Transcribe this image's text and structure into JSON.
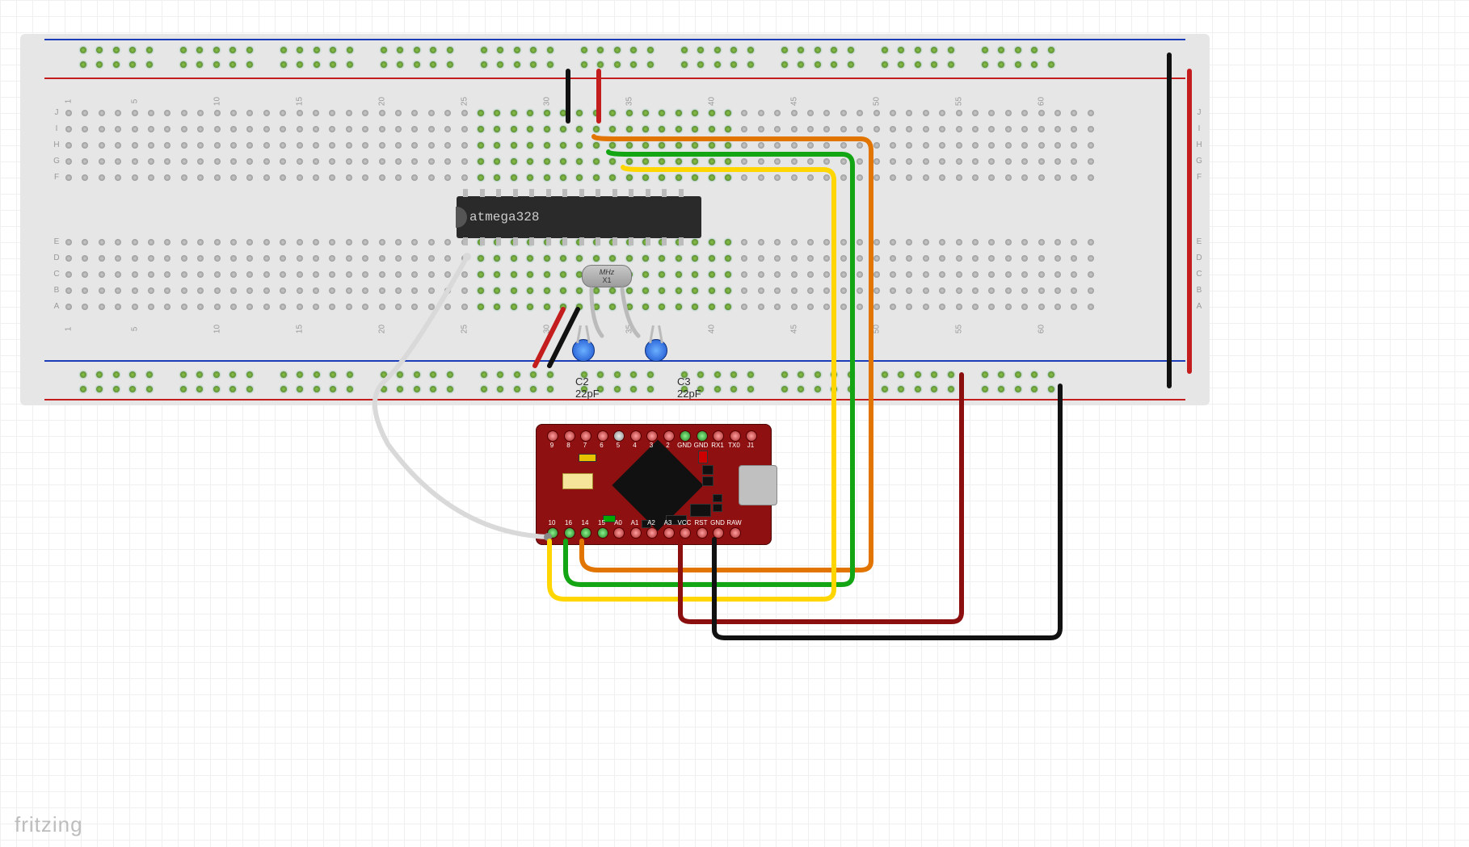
{
  "app": {
    "logo": "fritzing"
  },
  "chip": {
    "label": "atmega328"
  },
  "crystal": {
    "mhz": "MHz",
    "ref": "X1"
  },
  "capacitors": {
    "c2": {
      "ref": "C2",
      "value": "22pF"
    },
    "c3": {
      "ref": "C3",
      "value": "22pF"
    }
  },
  "mcu_board": {
    "top_pins": [
      "9",
      "8",
      "7",
      "6",
      "5",
      "4",
      "3",
      "2",
      "GND",
      "GND",
      "RX1",
      "TX0",
      "J1"
    ],
    "bottom_pins": [
      "10",
      "16",
      "14",
      "15",
      "A0",
      "A1",
      "A2",
      "A3",
      "VCC",
      "RST",
      "GND",
      "RAW"
    ]
  },
  "breadboard": {
    "columns": [
      "1",
      "5",
      "10",
      "15",
      "20",
      "25",
      "30",
      "35",
      "40",
      "45",
      "50",
      "55"
    ],
    "rows_top": [
      "J",
      "I",
      "H",
      "G",
      "F"
    ],
    "rows_bot": [
      "E",
      "D",
      "C",
      "B",
      "A"
    ]
  },
  "wires": [
    {
      "name": "gnd-top-jumper",
      "color": "#2a2a2a"
    },
    {
      "name": "vcc-top-jumper",
      "color": "#b01515"
    },
    {
      "name": "reset-wire",
      "color": "#d9d9d9"
    },
    {
      "name": "vcc-jumper-bot",
      "color": "#b01515"
    },
    {
      "name": "gnd-jumper-bot",
      "color": "#2a2a2a"
    },
    {
      "name": "miso-orange",
      "color": "#e27400"
    },
    {
      "name": "sck-green",
      "color": "#14a514"
    },
    {
      "name": "mosi-yellow",
      "color": "#ffd600"
    },
    {
      "name": "vcc-long-red",
      "color": "#8b0f0f"
    },
    {
      "name": "gnd-long-black",
      "color": "#111"
    },
    {
      "name": "gnd-right-black",
      "color": "#111"
    },
    {
      "name": "vcc-right-red",
      "color": "#b01515"
    }
  ]
}
